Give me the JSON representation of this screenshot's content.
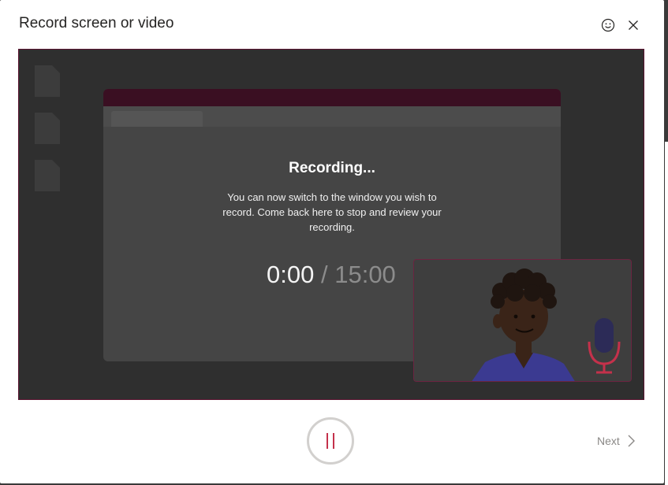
{
  "dialog": {
    "title": "Record screen or video"
  },
  "header": {
    "feedback_icon": "smiley-icon",
    "close_icon": "close-icon"
  },
  "recording": {
    "status": "Recording...",
    "description": "You can now switch to the window you wish to record. Come back here to stop and review your recording.",
    "elapsed": "0:00",
    "separator": "/",
    "limit": "15:00"
  },
  "footer": {
    "pause_icon": "pause-icon",
    "next_label": "Next",
    "next_icon": "chevron-right-icon"
  },
  "colors": {
    "accent": "#c4314b",
    "stage_border": "#5a1430",
    "mic": "#2c2b57",
    "shirt": "#3b3a91"
  }
}
